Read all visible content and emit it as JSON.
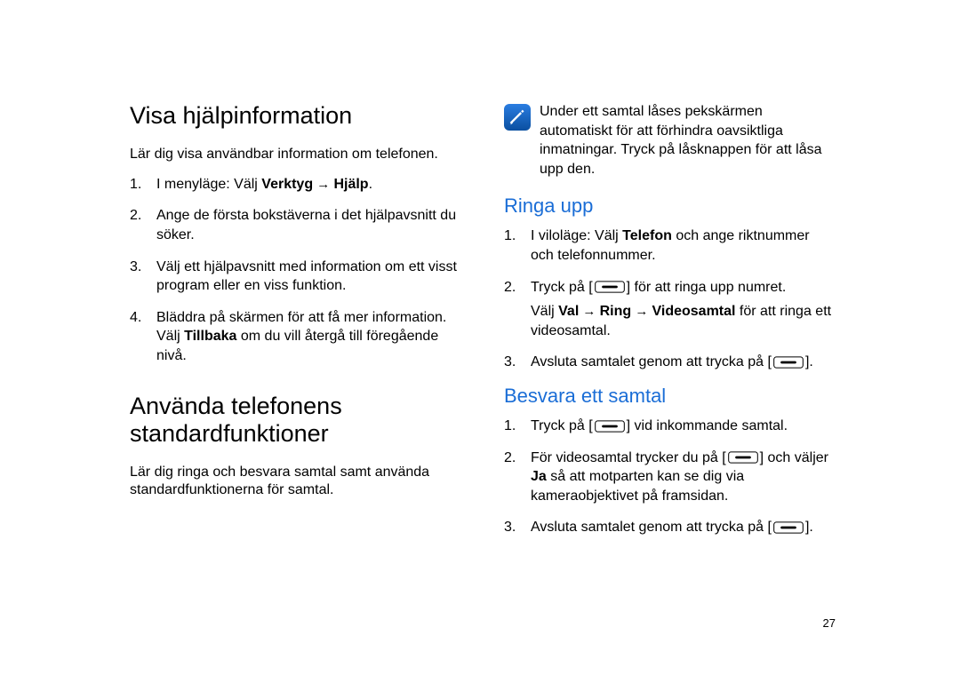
{
  "left": {
    "h1a": "Visa hjälpinformation",
    "intro_a": "Lär dig visa användbar information om telefonen.",
    "steps_a": {
      "s1_pre": "I menyläge: Välj ",
      "s1_b1": "Verktyg",
      "s1_arrow": " → ",
      "s1_b2": "Hjälp",
      "s1_post": ".",
      "s2": "Ange de första bokstäverna i det hjälpavsnitt du söker.",
      "s3": "Välj ett hjälpavsnitt med information om ett visst program eller en viss funktion.",
      "s4_pre": "Bläddra på skärmen för att få mer information. Välj ",
      "s4_b": "Tillbaka",
      "s4_post": " om du vill återgå till föregående nivå."
    },
    "h1b": "Använda telefonens standardfunktioner",
    "intro_b": "Lär dig ringa och besvara samtal samt använda standardfunktionerna för samtal."
  },
  "right": {
    "note": "Under ett samtal låses pekskärmen automatiskt för att förhindra oavsiktliga inmatningar. Tryck på låsknappen för att låsa upp den.",
    "h2a": "Ringa upp",
    "ring": {
      "s1_pre": "I viloläge: Välj ",
      "s1_b": "Telefon",
      "s1_post": " och ange riktnummer och telefonnummer.",
      "s2_pre": "Tryck på [",
      "s2_post": "] för att ringa upp numret.",
      "s2b_pre": "Välj ",
      "s2b_b1": "Val",
      "s2b_arrow1": " → ",
      "s2b_b2": "Ring",
      "s2b_arrow2": " → ",
      "s2b_b3": "Videosamtal",
      "s2b_post": " för att ringa ett videosamtal.",
      "s3_pre": "Avsluta samtalet genom att trycka på [",
      "s3_post": "]."
    },
    "h2b": "Besvara ett samtal",
    "ans": {
      "s1_pre": "Tryck på [",
      "s1_post": "] vid inkommande samtal.",
      "s2_pre": "För videosamtal trycker du på [",
      "s2_mid": "] och väljer ",
      "s2_b": "Ja",
      "s2_post": " så att motparten kan se dig via kameraobjektivet på framsidan.",
      "s3_pre": "Avsluta samtalet genom att trycka på [",
      "s3_post": "]."
    }
  },
  "page_number": "27"
}
